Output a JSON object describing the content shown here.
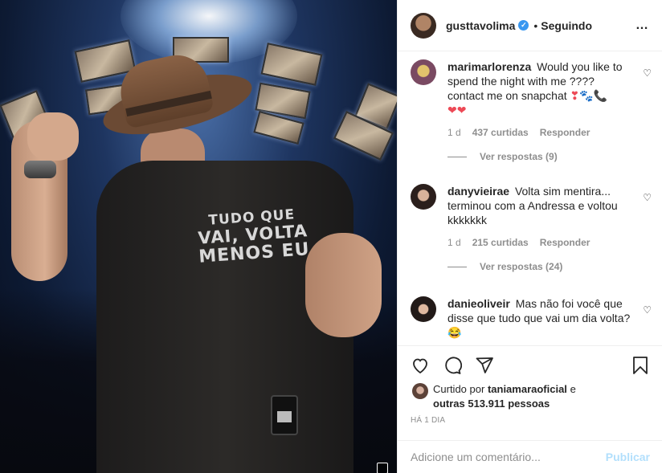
{
  "post": {
    "username": "gusttavolima",
    "verified_badge": "✓",
    "separator": "•",
    "follow_status": "Seguindo",
    "more_icon": "…",
    "photo": {
      "shirt_text": [
        "TUDO QUE",
        "VAI, VOLTA",
        "MENOS EU"
      ]
    }
  },
  "comments": [
    {
      "user": "marimarlorenza",
      "text": "Would you like to spend the night with me ???? contact me on snapchat",
      "emoji_inline": "❣🐾📞",
      "emoji_line": "❤❤",
      "time": "1 d",
      "likes": "437 curtidas",
      "reply_label": "Responder",
      "view_replies": "Ver respostas (9)"
    },
    {
      "user": "danyvieirae",
      "text": "Volta sim mentira... terminou com a Andressa e voltou kkkkkkk",
      "time": "1 d",
      "likes": "215 curtidas",
      "reply_label": "Responder",
      "view_replies": "Ver respostas (24)"
    },
    {
      "user": "danieoliveir",
      "text": "Mas não foi você que disse que tudo que vai um dia volta?",
      "emoji_inline": "😂"
    }
  ],
  "likes": {
    "prefix": "Curtido por",
    "liker": "taniamaraoficial",
    "connector": "e",
    "others": "outras 513.911 pessoas"
  },
  "timestamp": "HÁ 1 DIA",
  "add_comment": {
    "placeholder": "Adicione um comentário...",
    "post_label": "Publicar"
  },
  "icons": {
    "like": "heart-icon",
    "comment": "comment-icon",
    "share": "share-icon",
    "save": "bookmark-icon"
  }
}
